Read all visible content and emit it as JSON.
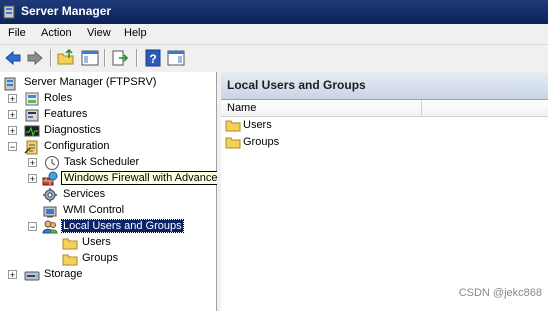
{
  "window": {
    "title": "Server Manager"
  },
  "menu": [
    "File",
    "Action",
    "View",
    "Help"
  ],
  "toolbar": {
    "icons": [
      "back-arrow-icon",
      "forward-arrow-icon",
      "up-folder-icon",
      "show-hide-tree-icon",
      "export-list-icon",
      "help-icon",
      "action-pane-icon"
    ]
  },
  "tree": {
    "root": "Server Manager (FTPSRV)",
    "roles": "Roles",
    "features": "Features",
    "diagnostics": "Diagnostics",
    "configuration": "Configuration",
    "task_scheduler": "Task Scheduler",
    "firewall": "Windows Firewall with Advanced Security",
    "services": "Services",
    "wmi": "WMI Control",
    "local_users": "Local Users and Groups",
    "users": "Users",
    "groups": "Groups",
    "storage": "Storage"
  },
  "content": {
    "header": "Local Users and Groups",
    "column_name": "Name",
    "items": [
      "Users",
      "Groups"
    ]
  },
  "watermark": "CSDN @jekc868",
  "colors": {
    "title_bar": "#0c2257",
    "selection": "#0a246a",
    "folder": "#f3cf5b",
    "tooltip_bg": "#ffffe1"
  }
}
